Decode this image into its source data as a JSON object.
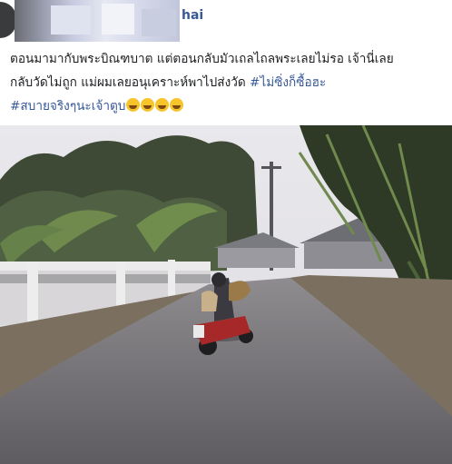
{
  "post": {
    "author_name_visible": "hai",
    "text_line1": "ตอนมามากับพระบิณฑบาต แต่ตอนกลับมัวเถลไถลพระเลยไม่รอ เจ้านี่เลย",
    "text_line2": "กลับวัดไม่ถูก แม่ผมเลยอนุเคราะห์พาไปส่งวัด ",
    "hashtag1": "#ไม่ซิ่งก็ซื้อฮะ",
    "hashtag2": "#สบายจริงๆนะเจ้าตูบ",
    "emojis": [
      "laughing-emoji",
      "laughing-emoji",
      "rofl-emoji",
      "smile-emoji"
    ]
  },
  "colors": {
    "text": "#1c1e21",
    "link": "#385898",
    "emoji": "#f7c42b"
  }
}
